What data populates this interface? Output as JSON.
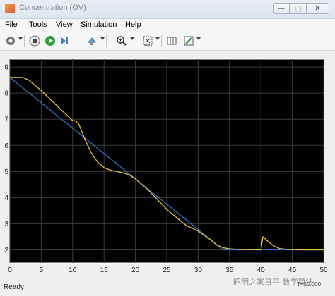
{
  "window": {
    "title": "Concentration (OV)",
    "controls": {
      "minimize": "—",
      "maximize": "□",
      "close": "✕"
    }
  },
  "menu": [
    "File",
    "Tools",
    "View",
    "Simulation",
    "Help"
  ],
  "toolbar": {
    "icons": [
      "gear-icon",
      "stop-icon",
      "run-icon",
      "step-forward-icon",
      "highlight-icon",
      "zoom-icon",
      "fit-to-view-icon",
      "cursor-measure-icon",
      "style-icon"
    ],
    "colors": {
      "run": "#2e9e3a",
      "stop": "#444444"
    }
  },
  "chart_data": {
    "type": "line",
    "background": "#000000",
    "grid": true,
    "xlim": [
      0,
      50
    ],
    "ylim": [
      1.5,
      9.3
    ],
    "xticks": [
      "0",
      "5",
      "10",
      "15",
      "20",
      "25",
      "30",
      "35",
      "40",
      "45",
      "50"
    ],
    "yticks": [
      "2",
      "3",
      "4",
      "5",
      "6",
      "7",
      "8",
      "9"
    ],
    "series": [
      {
        "color": "#2f6fbd",
        "x": [
          0,
          34,
          50
        ],
        "y": [
          8.6,
          2.0,
          2.0
        ]
      },
      {
        "color": "#e6c340",
        "x": [
          0,
          2,
          3,
          5,
          8,
          10,
          10.5,
          11,
          12,
          13,
          14,
          15,
          16,
          17,
          18,
          19,
          20,
          22,
          25,
          28,
          30,
          31,
          32,
          33,
          34,
          35,
          36,
          37,
          40,
          40.3,
          41,
          42,
          43,
          44,
          46,
          48,
          50
        ],
        "y": [
          8.6,
          8.6,
          8.5,
          8.1,
          7.4,
          6.95,
          6.93,
          6.8,
          6.2,
          5.7,
          5.35,
          5.15,
          5.05,
          5.0,
          4.95,
          4.87,
          4.72,
          4.3,
          3.55,
          2.95,
          2.72,
          2.55,
          2.38,
          2.18,
          2.08,
          2.04,
          2.02,
          2.01,
          2.0,
          2.5,
          2.35,
          2.15,
          2.05,
          2.02,
          2.0,
          2.0,
          2.0
        ]
      }
    ]
  },
  "status": {
    "ready": "Ready",
    "offset": "T=50.000",
    "watermark": "昭明之家日平·数学算法"
  }
}
